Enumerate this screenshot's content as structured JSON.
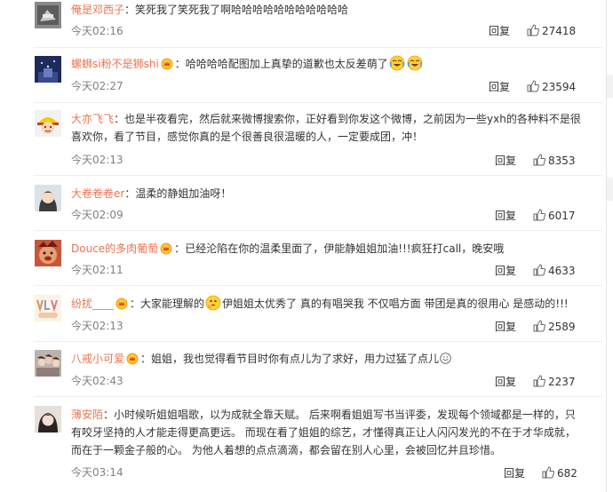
{
  "actions": {
    "reply_label": "回复"
  },
  "comments": [
    {
      "username": "俺是邓西子",
      "separator": "：",
      "text": "笑死我了笑死我了啊哈哈哈哈哈哈哈哈哈哈哈",
      "time": "今天02:16",
      "likes": "27418"
    },
    {
      "username": "螺蛳si粉不是狮shi",
      "separator": "：",
      "text": "哈哈哈哈配图加上真挚的道歉也太反差萌了",
      "time": "今天02:27",
      "likes": "23594"
    },
    {
      "username": "大亦飞飞",
      "separator": "：",
      "text": "也是半夜看完，然后就来微博搜索你，正好看到你发这个微博，之前因为一些yxh的各种料不是很喜欢你，看了节目，感觉你真的是个很善良很温暖的人，一定要成团，冲！",
      "time": "今天02:13",
      "likes": "8353"
    },
    {
      "username": "大卷卷卷er",
      "separator": "：",
      "text": "温柔的静姐加油呀！",
      "time": "今天02:09",
      "likes": "6017"
    },
    {
      "username": "Douce的多肉葡萄",
      "separator": "：",
      "text": "已经沦陷在你的温柔里面了，伊能静姐姐加油!!!疯狂打call，晚安哦",
      "time": "今天02:11",
      "likes": "4633"
    },
    {
      "username": "纷扰____",
      "separator": "：",
      "text_a": "大家能理解的",
      "text_b": "伊姐姐太优秀了 真的有唱哭我 不仅唱方面 带团是真的很用心 是感动的!!!",
      "time": "今天02:13",
      "likes": "2589"
    },
    {
      "username": "八戒小可爱",
      "separator": "：",
      "text": "姐姐，我也觉得看节目时你有点儿为了求好，用力过猛了点儿",
      "time": "今天02:43",
      "likes": "2237"
    },
    {
      "username": "薄安陌",
      "separator": "：",
      "text": "小时候听姐姐唱歌，以为成就全靠天赋。 后来啊看姐姐写书当评委，发现每个领域都是一样的，只有咬牙坚持的人才能走得更高更远。 而现在看了姐姐的综艺，才懂得真正让人闪闪发光的不在于才华成就，而在于一颗金子般的心。 为他人着想的点点滴滴，都会留在别人心里，会被回忆并且珍惜。",
      "time": "今天03:14",
      "likes": "682"
    }
  ]
}
